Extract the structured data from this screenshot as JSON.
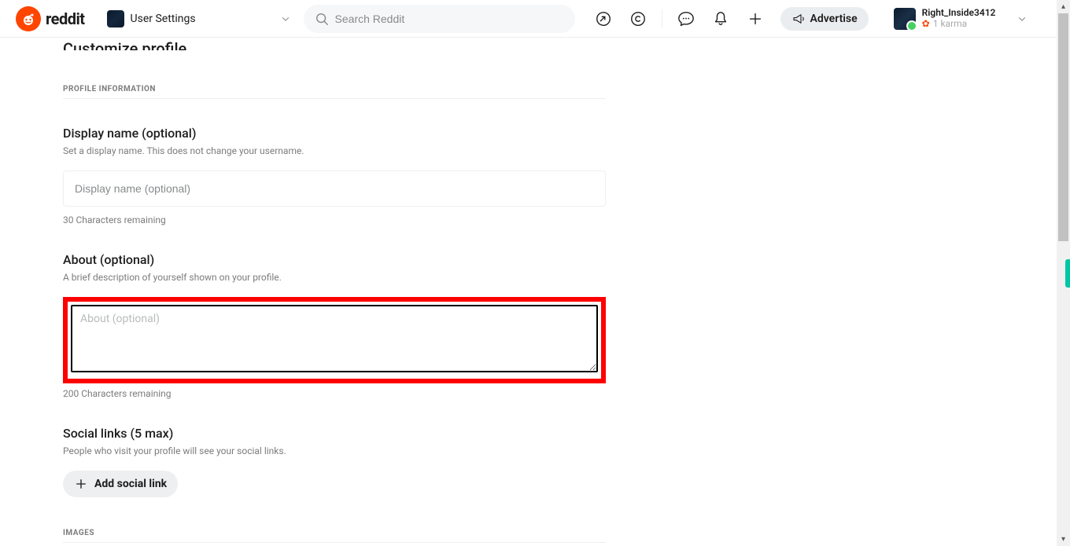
{
  "header": {
    "brand": "reddit",
    "community_label": "User Settings",
    "search_placeholder": "Search Reddit",
    "advertise_label": "Advertise",
    "user": {
      "name": "Right_Inside3412",
      "karma": "1 karma"
    }
  },
  "page": {
    "cut_title": "Customize profile",
    "sections": {
      "profile_info_label": "PROFILE INFORMATION",
      "display_name": {
        "title": "Display name (optional)",
        "desc": "Set a display name. This does not change your username.",
        "placeholder": "Display name (optional)",
        "remaining": "30 Characters remaining"
      },
      "about": {
        "title": "About (optional)",
        "desc": "A brief description of yourself shown on your profile.",
        "placeholder": "About (optional)",
        "remaining": "200 Characters remaining"
      },
      "social": {
        "title": "Social links (5 max)",
        "desc": "People who visit your profile will see your social links.",
        "add_label": "Add social link"
      },
      "images_label": "IMAGES"
    }
  }
}
